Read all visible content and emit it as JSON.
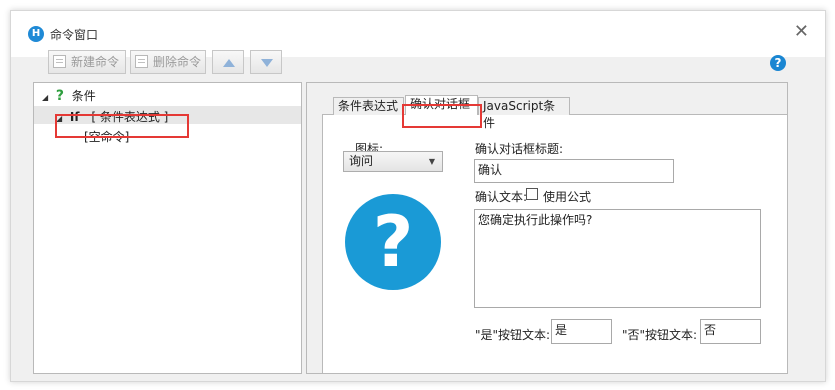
{
  "window": {
    "title": "命令窗口",
    "app_icon_letter": "H",
    "close_glyph": "✕"
  },
  "toolbar": {
    "new_label": "新建命令",
    "delete_label": "删除命令",
    "up_icon": "arrow-up-icon",
    "down_icon": "arrow-down-icon",
    "help_glyph": "?"
  },
  "tree": {
    "condition_label": "条件",
    "condition_glyph": "?",
    "if_keyword": "If",
    "if_expr": "[ 条件表达式 ]",
    "empty_command": "[空命令]"
  },
  "tabs": [
    {
      "label": "条件表达式",
      "active": false
    },
    {
      "label": "确认对话框",
      "active": true
    },
    {
      "label": "JavaScript条件",
      "active": false
    }
  ],
  "form": {
    "icon_label": "图标:",
    "icon_value": "询问",
    "dialog_title_label": "确认对话框标题:",
    "dialog_title_value": "确认",
    "confirm_text_label": "确认文本:",
    "use_formula_label": "使用公式",
    "use_formula_checked": false,
    "confirm_text_value": "您确定执行此操作吗?",
    "yes_label": "\"是\"按钮文本:",
    "yes_value": "是",
    "no_label": "\"否\"按钮文本:",
    "no_value": "否",
    "preview_glyph": "?"
  },
  "colors": {
    "highlight": "#e53935",
    "question_blue": "#1a9ad6",
    "condition_green": "#2e9e3e"
  }
}
